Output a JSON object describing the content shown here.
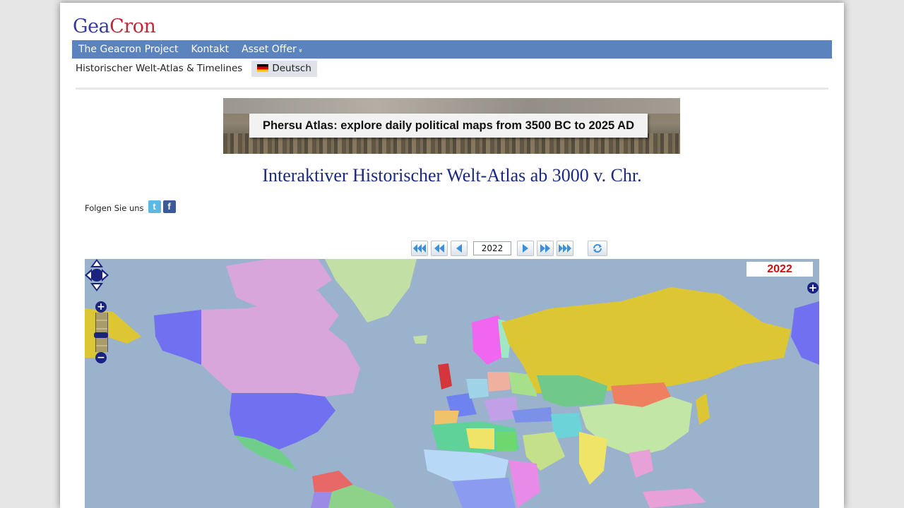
{
  "logo": {
    "part1": "Gea",
    "part2": "Cron"
  },
  "nav": {
    "project": "The Geacron Project",
    "contact": "Kontakt",
    "asset_offer": "Asset Offer",
    "asset_chevron": "»"
  },
  "subnav": {
    "atlas_link": "Historischer Welt-Atlas & Timelines",
    "language": "Deutsch",
    "flag_icon": "german-flag-icon"
  },
  "banner": {
    "text": "Phersu Atlas: explore daily political maps from 3500 BC to 2025 AD"
  },
  "title": "Interaktiver Historischer Welt-Atlas ab 3000 v. Chr.",
  "follow": {
    "label": "Folgen Sie uns",
    "twitter_glyph": "t",
    "facebook_glyph": "f"
  },
  "timeline": {
    "year_value": "2022",
    "buttons": [
      "fast-backward-icon",
      "step-backward-icon",
      "prev-icon",
      "next-icon",
      "step-forward-icon",
      "fast-forward-icon",
      "refresh-icon"
    ],
    "button_color": "#3f8fd6"
  },
  "map": {
    "year_label": "2022",
    "year_color": "#cc1111",
    "ocean_color": "#9bb2cc",
    "zoom_in": "+",
    "zoom_out": "−",
    "expand": "+"
  }
}
